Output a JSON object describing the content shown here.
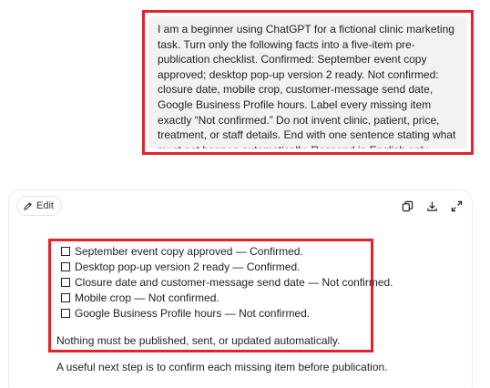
{
  "user_prompt": {
    "text": "I am a beginner using ChatGPT for a fictional clinic marketing task. Turn only the following facts into a five-item pre-publication checklist. Confirmed: September event copy approved; desktop pop-up version 2 ready. Not confirmed: closure date, mobile crop, customer-message send date, Google Business Profile hours. Label every missing item exactly “Not confirmed.” Do not invent clinic, patient, price, treatment, or staff details. End with one sentence stating what must not happen automatically. Respond in English only."
  },
  "response": {
    "edit_label": "Edit",
    "toolbar_icons": [
      "copy-icon",
      "download-icon",
      "expand-icon"
    ],
    "checklist": [
      {
        "text": "September event copy approved — Confirmed.",
        "checked": false
      },
      {
        "text": "Desktop pop-up version 2 ready — Confirmed.",
        "checked": false
      },
      {
        "text": "Closure date and customer-message send date — Not confirmed.",
        "checked": false
      },
      {
        "text": "Mobile crop — Not confirmed.",
        "checked": false
      },
      {
        "text": "Google Business Profile hours — Not confirmed.",
        "checked": false
      }
    ],
    "closing_sentence": "Nothing must be published, sent, or updated automatically.",
    "next_step": "A useful next step is to confirm each missing item before publication."
  },
  "colors": {
    "highlight": "#e5212b",
    "user_bubble_bg": "#f2f2f2",
    "text": "#1f1f1f"
  }
}
